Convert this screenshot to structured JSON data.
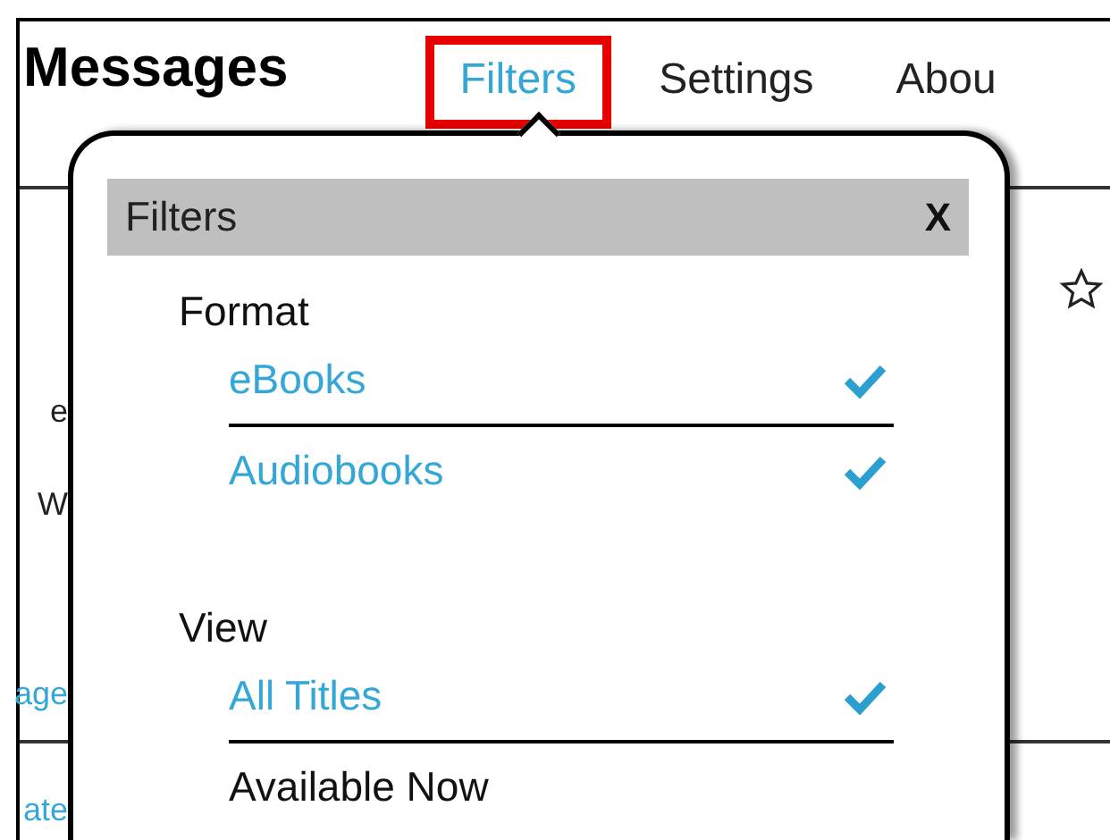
{
  "header": {
    "title": "Messages"
  },
  "nav": [
    {
      "label": "Filters",
      "selected": true
    },
    {
      "label": "Settings",
      "selected": false
    },
    {
      "label": "Abou",
      "selected": false
    }
  ],
  "background": {
    "left_texts": [
      {
        "text": "e",
        "kind": "plain"
      },
      {
        "text": "W",
        "kind": "plain"
      },
      {
        "text": "age",
        "kind": "link"
      },
      {
        "text": "ate",
        "kind": "link"
      }
    ]
  },
  "filters_popup": {
    "title": "Filters",
    "close": "X",
    "groups": [
      {
        "heading": "Format",
        "options": [
          {
            "label": "eBooks",
            "selected": true
          },
          {
            "label": "Audiobooks",
            "selected": true
          }
        ]
      },
      {
        "heading": "View",
        "options": [
          {
            "label": "All Titles",
            "selected": true
          },
          {
            "label": "Available Now",
            "selected": false
          }
        ]
      }
    ]
  }
}
